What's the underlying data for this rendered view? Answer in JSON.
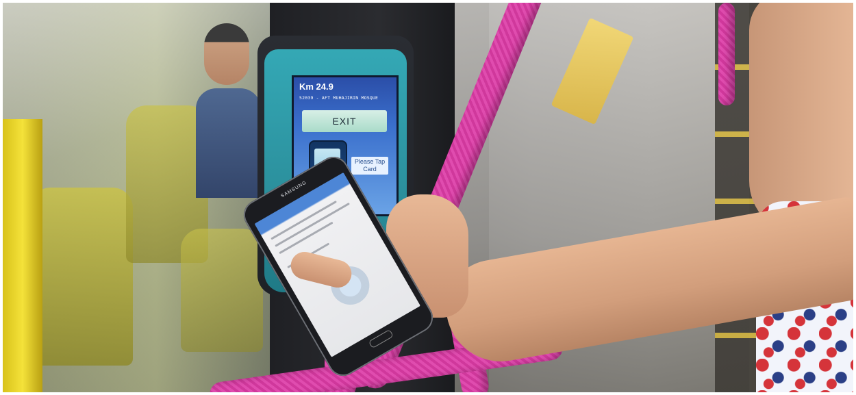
{
  "validator": {
    "distance": "Km 24.9",
    "stop": "52039 - AFT MUHAJIRIN MOSQUE",
    "exit_label": "EXIT",
    "tap_prompt": "Please Tap Card"
  },
  "phone": {
    "brand": "SAMSUNG"
  }
}
